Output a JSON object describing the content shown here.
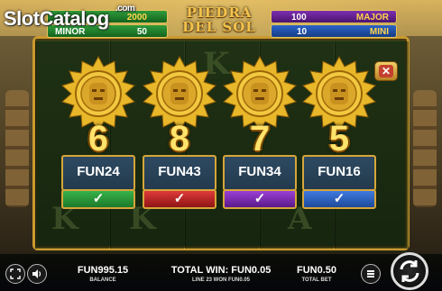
{
  "watermark": {
    "text": "SlotCatalog",
    "suffix": ".com"
  },
  "logo": {
    "line1": "PIEDRA",
    "line2": "DEL SOL"
  },
  "jackpots": {
    "minor": {
      "value": "50",
      "label": "MINOR",
      "top_value": "2000"
    },
    "major": {
      "value": "100",
      "label": "MAJOR"
    },
    "mini": {
      "value": "10",
      "label": "MINI"
    }
  },
  "bonus_cards": [
    {
      "number": "6",
      "label": "FUN24",
      "check_color": "#2ea043"
    },
    {
      "number": "8",
      "label": "FUN43",
      "check_color": "#d32f2f"
    },
    {
      "number": "7",
      "label": "FUN34",
      "check_color": "#8e2fc4"
    },
    {
      "number": "5",
      "label": "FUN16",
      "check_color": "#2f64d3"
    }
  ],
  "check_glyph": "✓",
  "close_glyph": "✕",
  "bottom_bar": {
    "balance_value": "FUN995.15",
    "balance_label": "BALANCE",
    "total_win": "TOTAL WIN: FUN0.05",
    "line_win": "LINE 23 WON FUN0.05",
    "total_bet_value": "FUN0.50",
    "total_bet_label": "TOTAL BET"
  },
  "icons": {
    "fullscreen": "fullscreen-icon",
    "sound": "speaker-icon",
    "bet": "coin-stack-icon",
    "spin": "spin-arrows-icon"
  },
  "colors": {
    "gold": "#d6a63a",
    "plate": "#2d4a62",
    "accent_yellow": "#ffe36a"
  }
}
